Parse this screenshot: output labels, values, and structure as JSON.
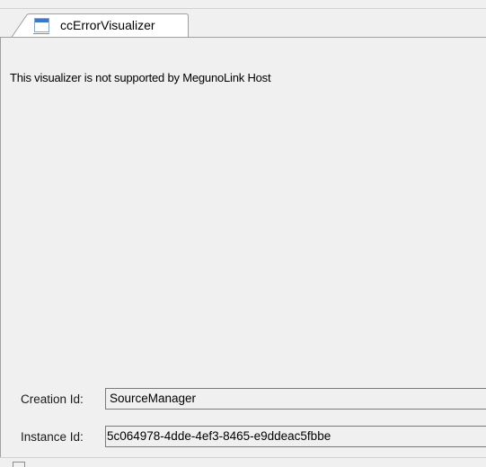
{
  "tab": {
    "label": "ccErrorVisualizer",
    "icon": "window-icon"
  },
  "main": {
    "message": "This visualizer is not supported by MegunoLink Host"
  },
  "fields": {
    "creation_id": {
      "label": "Creation Id:",
      "value": "SourceManager"
    },
    "instance_id": {
      "label": "Instance Id:",
      "value": "5c064978-4dde-4ef3-8465-e9ddeac5fbbe"
    }
  },
  "colors": {
    "background": "#f0f0f0",
    "border": "#a0a0a0",
    "icon_accent": "#3c78c8"
  }
}
